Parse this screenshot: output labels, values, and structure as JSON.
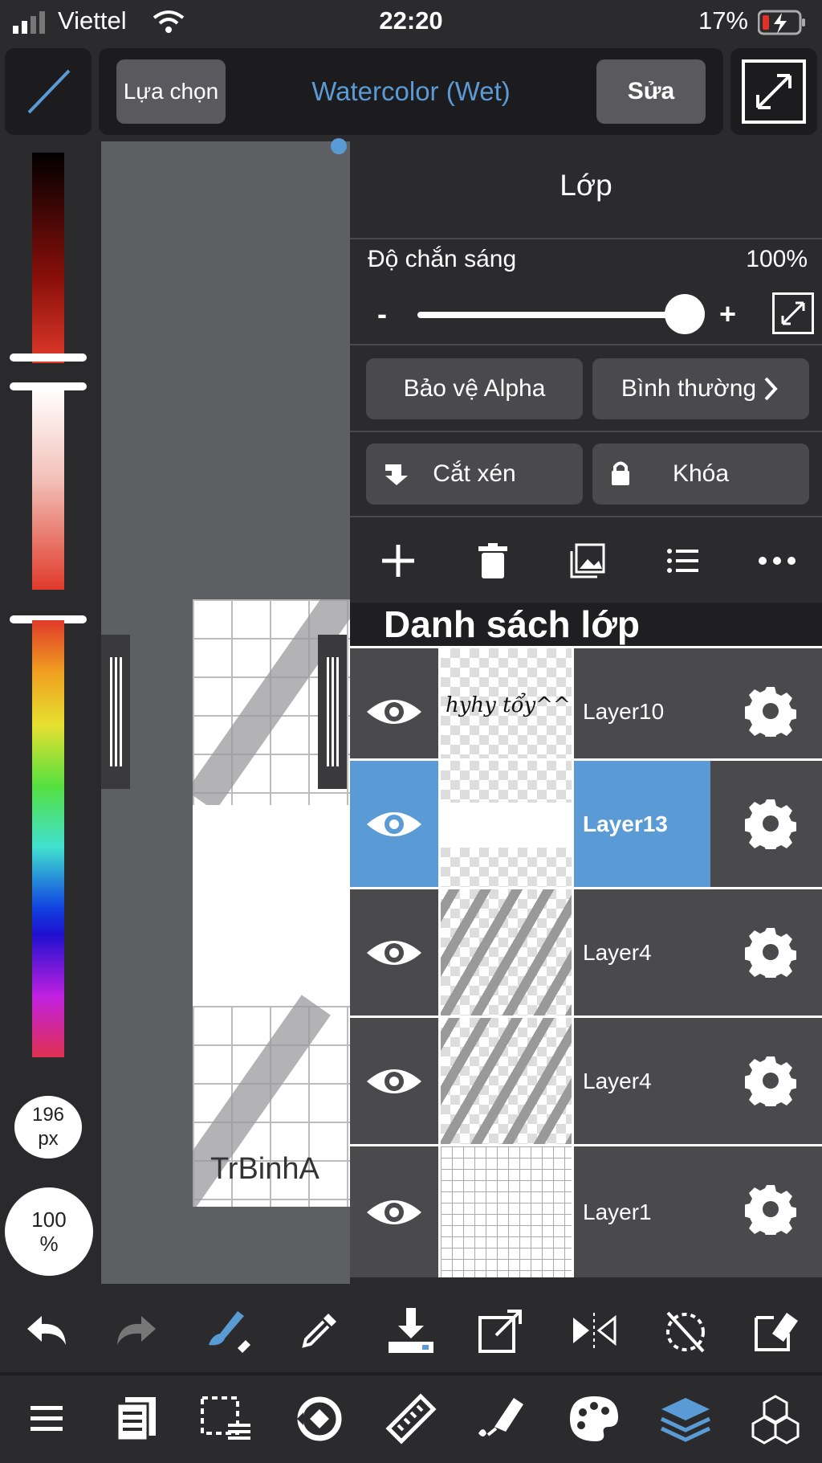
{
  "status_bar": {
    "carrier": "Viettel",
    "time": "22:20",
    "battery": "17%",
    "icons": [
      "signal-icon",
      "wifi-icon",
      "battery-charging-icon"
    ]
  },
  "top_toolbar": {
    "select_label": "Lựa chọn",
    "brush_name": "Watercolor (Wet)",
    "edit_label": "Sửa",
    "icons": [
      "pen-line-icon",
      "fullscreen-icon"
    ]
  },
  "color_panel": {
    "brush_size_value": "196",
    "brush_size_unit": "px",
    "opacity_value": "100",
    "opacity_unit": "%"
  },
  "canvas": {
    "watermark": "TrBinhA"
  },
  "layer_panel": {
    "title": "Lớp",
    "opacity_label": "Độ chắn sáng",
    "opacity_value": "100%",
    "opacity_level": 1.0,
    "minus": "-",
    "plus": "+",
    "alpha_protect": "Bảo vệ Alpha",
    "blend_mode": "Bình thường",
    "clipping": "Cắt xén",
    "lock": "Khóa",
    "list_title": "Danh sách lớp",
    "layers": [
      {
        "name": "Layer10",
        "selected": false,
        "thumb_text": "hyhy tổy^^"
      },
      {
        "name": "Layer13",
        "selected": true
      },
      {
        "name": "Layer4",
        "selected": false
      },
      {
        "name": "Layer4",
        "selected": false
      },
      {
        "name": "Layer1",
        "selected": false
      }
    ],
    "action_icons": [
      "add-layer-icon",
      "delete-layer-icon",
      "image-layer-icon",
      "layer-list-icon",
      "more-icon"
    ]
  },
  "bottom_toolbar": {
    "row1": [
      "undo-icon",
      "redo-icon",
      "brush-tool-icon",
      "eyedropper-icon",
      "download-icon",
      "transform-icon",
      "flip-icon",
      "rotate-reset-icon",
      "eraser-icon"
    ],
    "row2": [
      "menu-icon",
      "pages-icon",
      "selection-icon",
      "snap-icon",
      "ruler-icon",
      "fill-icon",
      "palette-icon",
      "layers-icon",
      "materials-icon"
    ]
  },
  "colors": {
    "accent": "#5b9bd5",
    "panel": "#2b2b2d",
    "button": "#4a4a4c"
  }
}
